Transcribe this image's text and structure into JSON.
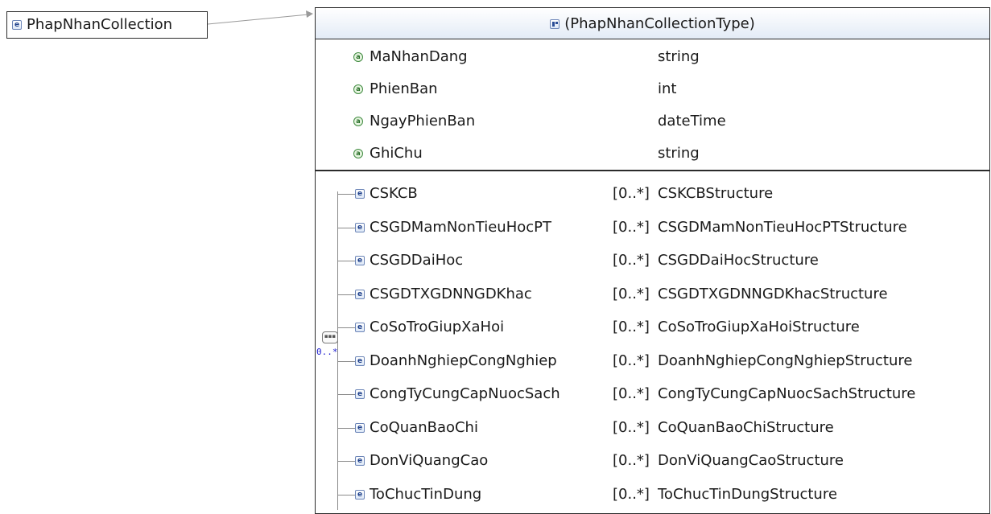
{
  "root": {
    "name": "PhapNhanCollection",
    "icon": "element-icon"
  },
  "type_box": {
    "title": "(PhapNhanCollectionType)",
    "icon": "complex-type-icon",
    "attributes": [
      {
        "name": "MaNhanDang",
        "type": "string"
      },
      {
        "name": "PhienBan",
        "type": "int"
      },
      {
        "name": "NgayPhienBan",
        "type": "dateTime"
      },
      {
        "name": "GhiChu",
        "type": "string"
      }
    ],
    "sequence": {
      "compositor": "sequence-icon",
      "multiplicity": "0..*",
      "elements": [
        {
          "name": "CSKCB",
          "mult": "[0..*]",
          "type": "CSKCBStructure"
        },
        {
          "name": "CSGDMamNonTieuHocPT",
          "mult": "[0..*]",
          "type": "CSGDMamNonTieuHocPTStructure"
        },
        {
          "name": "CSGDDaiHoc",
          "mult": "[0..*]",
          "type": "CSGDDaiHocStructure"
        },
        {
          "name": "CSGDTXGDNNGDKhac",
          "mult": "[0..*]",
          "type": "CSGDTXGDNNGDKhacStructure"
        },
        {
          "name": "CoSoTroGiupXaHoi",
          "mult": "[0..*]",
          "type": "CoSoTroGiupXaHoiStructure"
        },
        {
          "name": "DoanhNghiepCongNghiep",
          "mult": "[0..*]",
          "type": "DoanhNghiepCongNghiepStructure"
        },
        {
          "name": "CongTyCungCapNuocSach",
          "mult": "[0..*]",
          "type": "CongTyCungCapNuocSachStructure"
        },
        {
          "name": "CoQuanBaoChi",
          "mult": "[0..*]",
          "type": "CoQuanBaoChiStructure"
        },
        {
          "name": "DonViQuangCao",
          "mult": "[0..*]",
          "type": "DonViQuangCaoStructure"
        },
        {
          "name": "ToChucTinDung",
          "mult": "[0..*]",
          "type": "ToChucTinDungStructure"
        }
      ]
    }
  }
}
